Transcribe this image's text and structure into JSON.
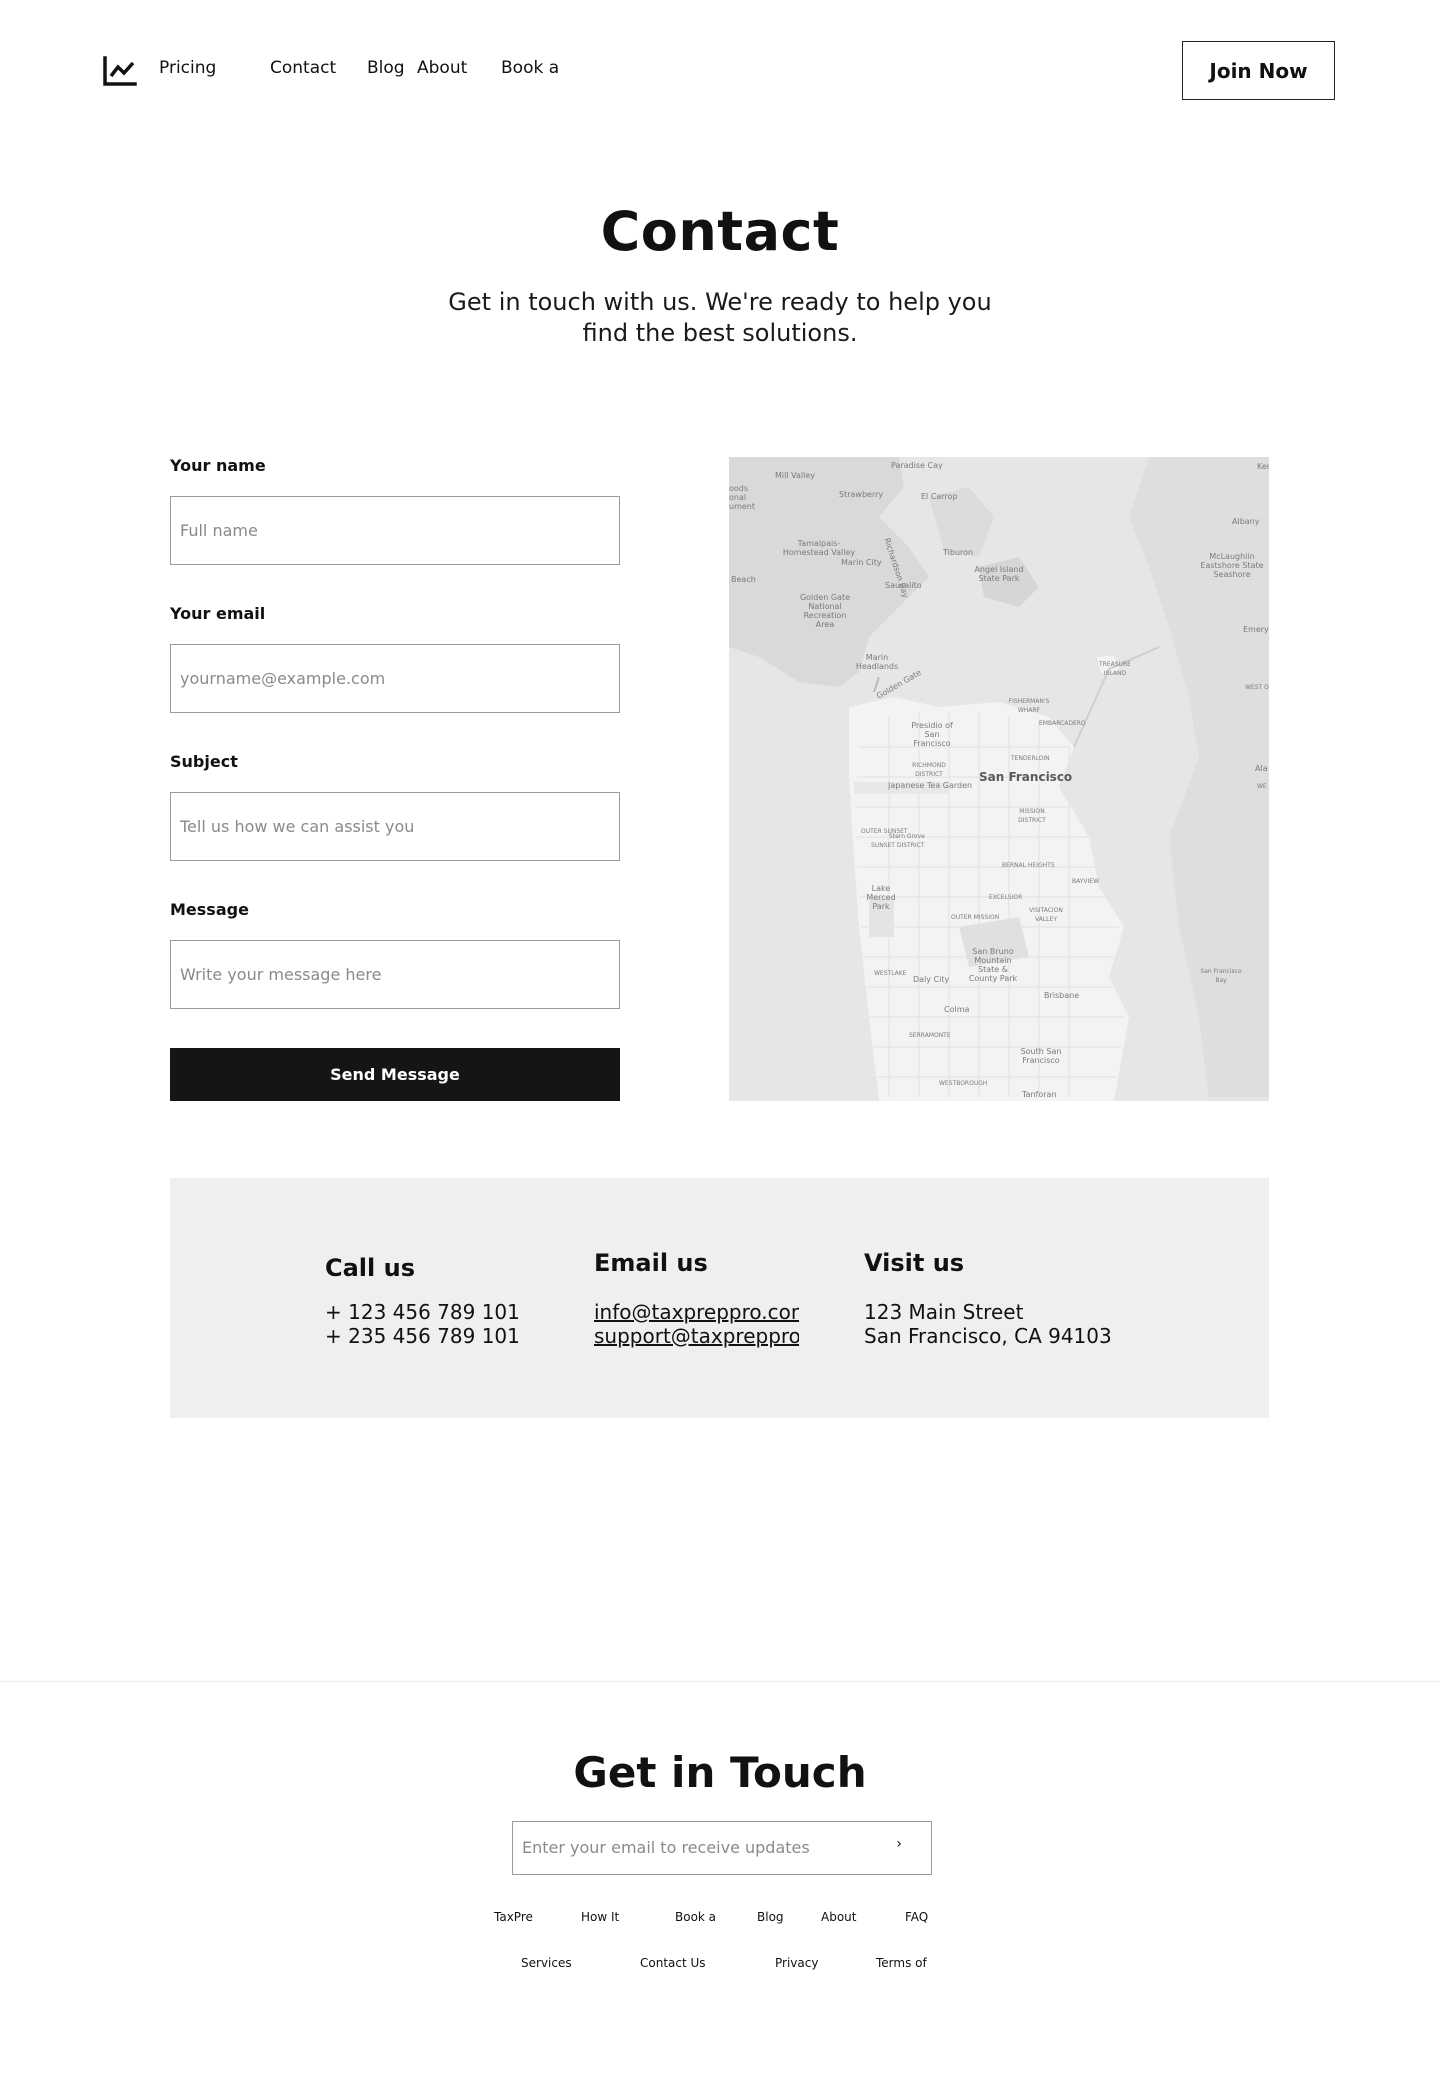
{
  "header": {
    "logo": "line-chart-logo",
    "nav": {
      "pricing": "Pricing",
      "contact": "Contact",
      "blog": "Blog",
      "about": "About",
      "book": "Book a"
    },
    "join_label": "Join Now"
  },
  "hero": {
    "title": "Contact",
    "subtitle": "Get in touch with us. We're ready to help you find the best solutions."
  },
  "form": {
    "name_label": "Your name",
    "name_placeholder": "Full name",
    "email_label": "Your email",
    "email_placeholder": "yourname@example.com",
    "subject_label": "Subject",
    "subject_placeholder": "Tell us how we can assist you",
    "message_label": "Message",
    "message_placeholder": "Write your message here",
    "send_label": "Send Message"
  },
  "map": {
    "labels": {
      "mill_valley": "Mill Valley",
      "paradise_cay": "Paradise Cay",
      "strawberry": "Strawberry",
      "el_carrrop": "El Carrop",
      "woods": "oods",
      "onal": "onal",
      "ument": "ument",
      "tamalpais": "Tamalpais-Homestead Valley",
      "richardson_bay": "Richardson Bay",
      "tiburon": "Tiburon",
      "marin_city": "Marin City",
      "beach": "Beach",
      "sausalito": "Sausalito",
      "angel_island": "Angel Island State Park",
      "golden_gate_nra": "Golden Gate National Recreation Area",
      "marin_headlands": "Marin Headlands",
      "golden_gate": "Golden Gate",
      "treasure_island": "TREASURE ISLAND",
      "fishermans_wharf": "FISHERMAN'S WHARF",
      "embarcadero": "EMBARCADERO",
      "presidio": "Presidio of San Francisco",
      "tenderloin": "TENDERLOIN",
      "richmond": "RICHMOND DISTRICT",
      "san_francisco": "San Francisco",
      "japanese_tea_garden": "Japanese Tea Garden",
      "mission": "MISSION DISTRICT",
      "outer_sunset": "OUTER SUNSET",
      "sunset_district": "SUNSET DISTRICT",
      "stern_grove": "Stern Grove",
      "bernal_heights": "BERNAL HEIGHTS",
      "bayview": "BAYVIEW",
      "lake_merced": "Lake Merced Park",
      "excelsior": "EXCELSIOR",
      "outer_mission": "OUTER MISSION",
      "visitacion": "VISITACION VALLEY",
      "san_bruno_mtn": "San Bruno Mountain State & County Park",
      "westlake": "WESTLAKE",
      "daly_city": "Daly City",
      "brisbane": "Brisbane",
      "colma": "Colma",
      "serramonte": "SERRAMONTE",
      "south_sf": "South San Francisco",
      "westborough": "WESTBOROUGH",
      "tanforan": "Tanforan",
      "sf_bay": "San Francisco Bay",
      "albany": "Albany",
      "mclaughlin": "McLaughlin Eastshore State Seashore",
      "emeryville": "Emeryvi",
      "west_o": "WEST O",
      "ala": "Ala",
      "we": "WE",
      "ken": "Ken"
    }
  },
  "contact_info": {
    "call_title": "Call us",
    "phone_1": "+ 123 456 789 101",
    "phone_2": "+ 235 456 789 101",
    "email_title": "Email us",
    "email_1": "info@taxpreppro.com",
    "email_2": "support@taxpreppro.com",
    "visit_title": "Visit us",
    "address_1": "123 Main Street",
    "address_2": "San Francisco, CA 94103"
  },
  "footer": {
    "title": "Get in Touch",
    "subscribe_placeholder": "Enter your email to receive updates",
    "subscribe_arrow": "›",
    "links_row1": [
      "TaxPre",
      "How It",
      "Book a",
      "Blog",
      "About",
      "FAQ"
    ],
    "links_row2": [
      "Services",
      "Contact Us",
      "Privacy",
      "Terms of"
    ]
  }
}
